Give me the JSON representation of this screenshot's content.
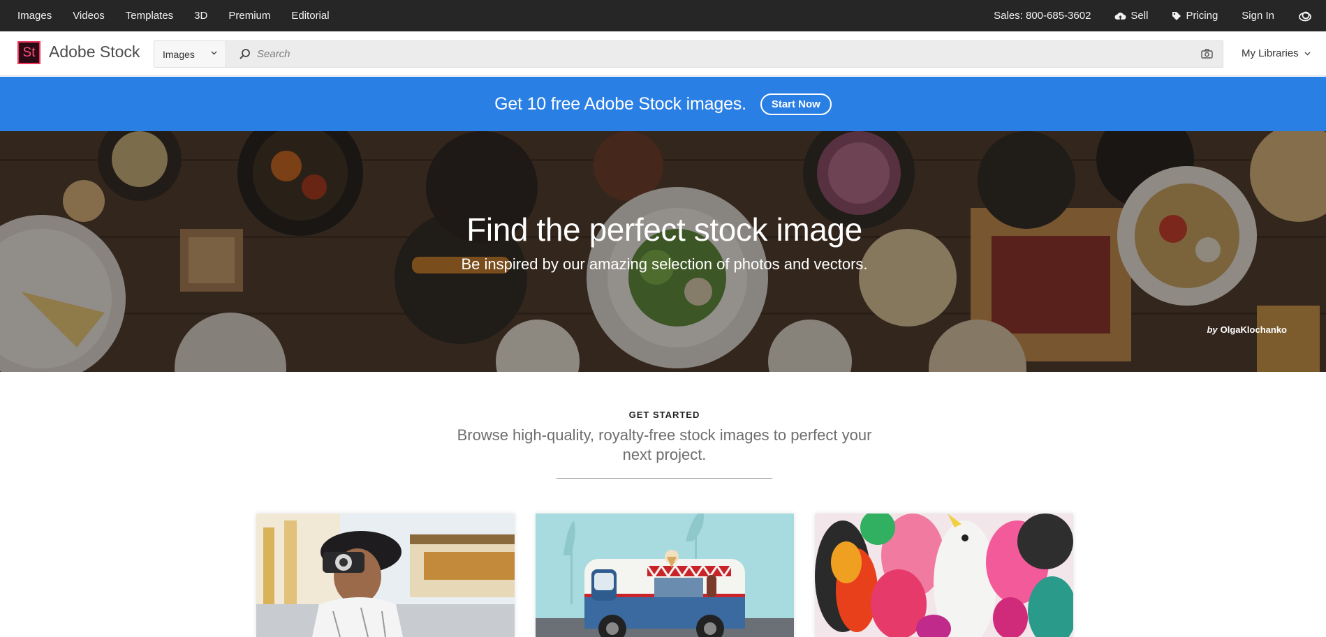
{
  "topbar": {
    "nav": [
      "Images",
      "Videos",
      "Templates",
      "3D",
      "Premium",
      "Editorial"
    ],
    "sales": "Sales: 800-685-3602",
    "sell": "Sell",
    "pricing": "Pricing",
    "sign_in": "Sign In",
    "icons": {
      "sell": "cloud-upload-icon",
      "pricing": "tag-icon",
      "creative_cloud": "creative-cloud-icon"
    }
  },
  "header": {
    "logo_mark": "St",
    "logo_text": "Adobe Stock",
    "search_type": "Images",
    "search_placeholder": "Search",
    "my_libraries": "My Libraries",
    "icons": {
      "search": "search-icon",
      "camera": "camera-icon",
      "dropdown": "chevron-down-icon"
    }
  },
  "promo": {
    "text": "Get 10 free Adobe Stock images.",
    "button": "Start Now",
    "background": "#2a7fe5"
  },
  "hero": {
    "title": "Find the perfect stock image",
    "subtitle": "Be inspired by our amazing selection of photos and vectors.",
    "credit_by": "by",
    "credit_author": "OlgaKlochanko"
  },
  "get_started": {
    "label": "GET STARTED",
    "description": "Browse high-quality, royalty-free stock images to perfect your next project."
  },
  "colors": {
    "topbar": "#262626",
    "brand_pink": "#f2365e",
    "accent_blue": "#2a7fe5"
  }
}
